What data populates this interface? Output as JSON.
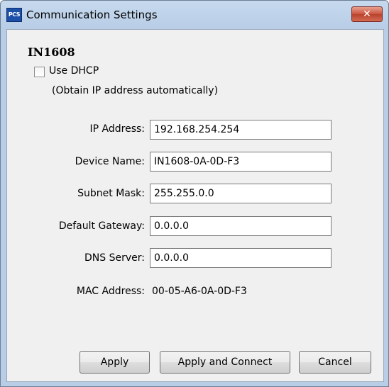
{
  "window": {
    "title": "Communication Settings",
    "icon_text": "PCS",
    "close_glyph": "✕"
  },
  "device": {
    "name": "IN1608"
  },
  "dhcp": {
    "label": "Use DHCP",
    "note": "(Obtain IP address automatically)",
    "checked": false
  },
  "fields": {
    "ip_address": {
      "label": "IP Address:",
      "value": "192.168.254.254"
    },
    "device_name": {
      "label": "Device Name:",
      "value": "IN1608-0A-0D-F3"
    },
    "subnet_mask": {
      "label": "Subnet Mask:",
      "value": "255.255.0.0"
    },
    "default_gateway": {
      "label": "Default Gateway:",
      "value": "0.0.0.0"
    },
    "dns_server": {
      "label": "DNS Server:",
      "value": "0.0.0.0"
    }
  },
  "mac": {
    "label": "MAC Address:",
    "value": "00-05-A6-0A-0D-F3"
  },
  "buttons": {
    "apply": "Apply",
    "apply_connect": "Apply and Connect",
    "cancel": "Cancel"
  },
  "icons": {
    "app": "pcs-app-icon",
    "close": "close-icon"
  },
  "colors": {
    "titlebar": "#b8cde6",
    "close_button": "#c9533d",
    "client_background": "#f0f0f0"
  }
}
